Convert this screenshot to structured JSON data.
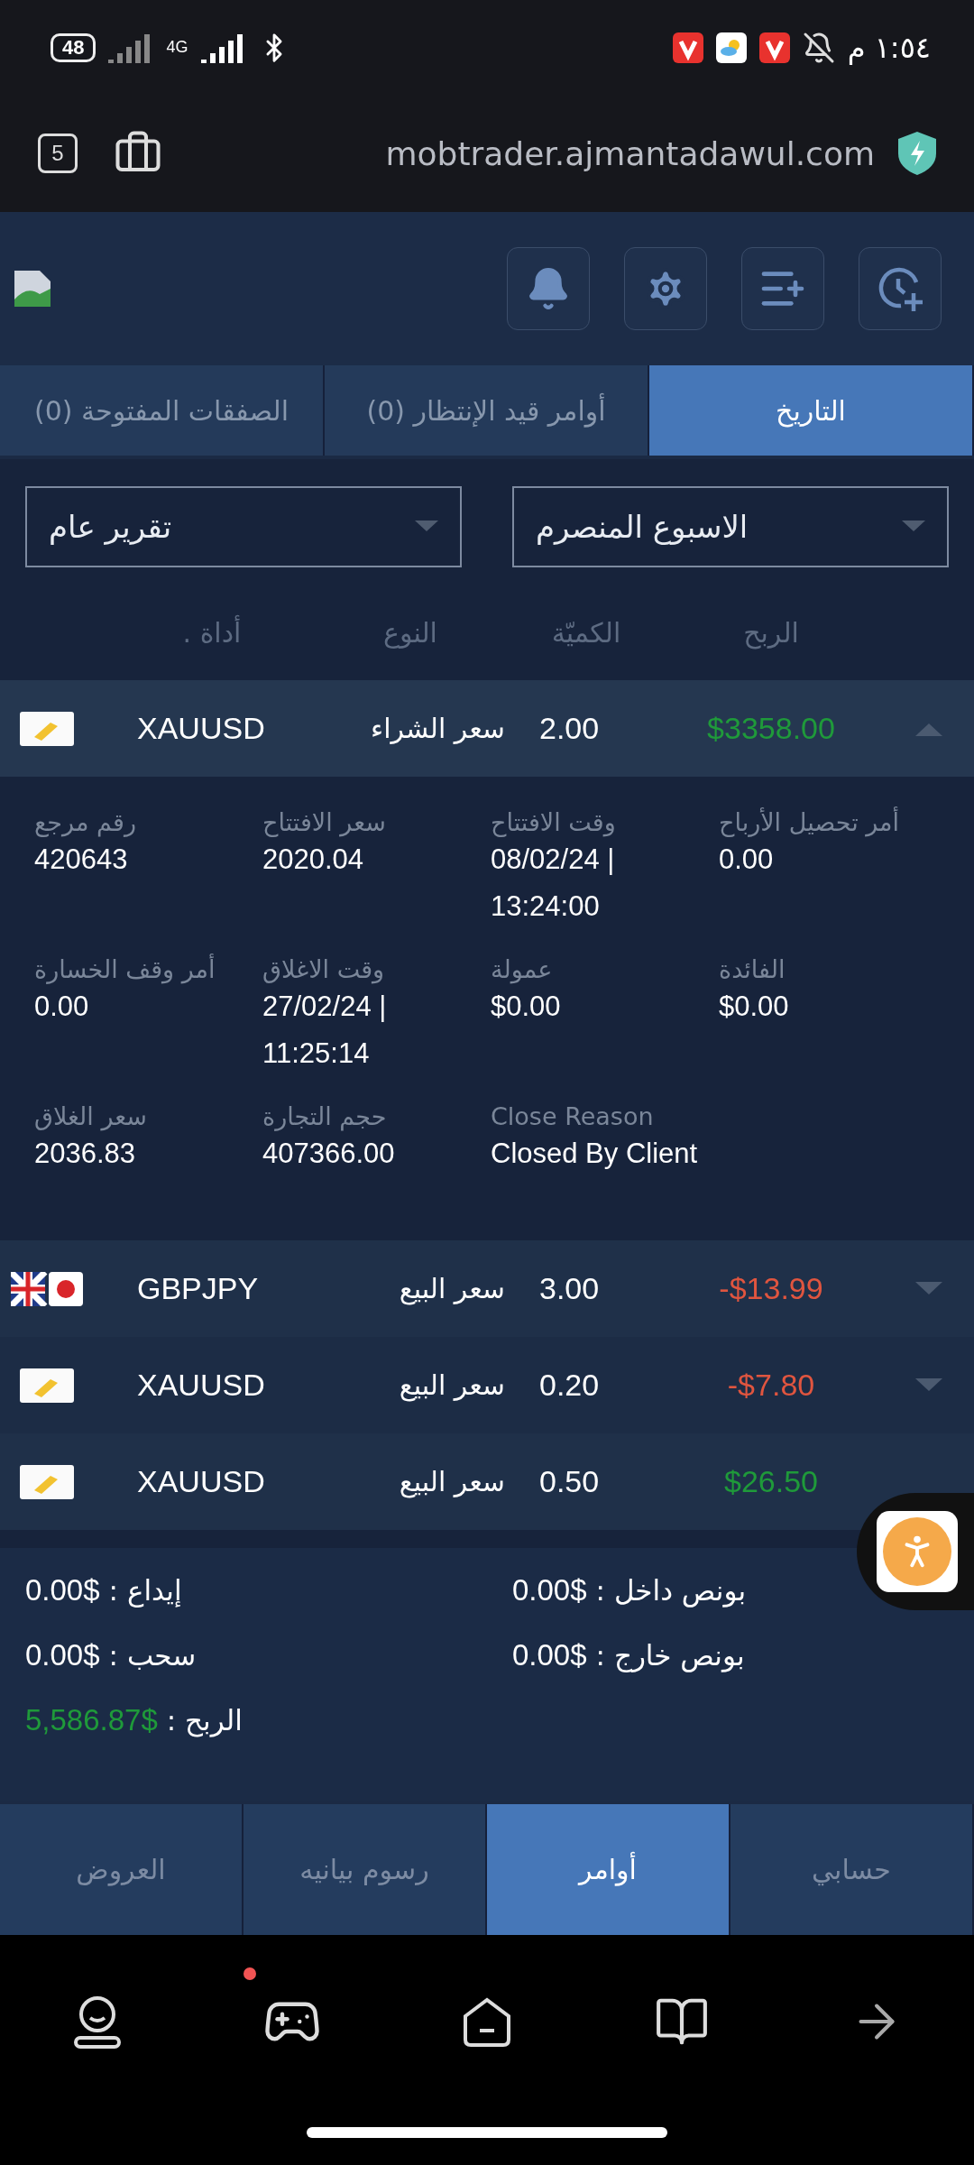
{
  "status_bar": {
    "battery": "48",
    "network": "4G",
    "time": "١:٥٤ م"
  },
  "browser": {
    "tab_count": "5",
    "url": "mobtrader.ajmantadawul.com"
  },
  "tabs": [
    {
      "label": "التاريخ",
      "selected": true
    },
    {
      "label": "أوامر قيد الإنتظار (0)",
      "selected": false
    },
    {
      "label": "الصفقات المفتوحة (0)",
      "selected": false
    }
  ],
  "filters": [
    {
      "value": "الاسبوع المنصرم"
    },
    {
      "value": "تقرير عام"
    }
  ],
  "columns": [
    "الربح",
    "الكميّة",
    "النوع",
    "أداة ."
  ],
  "trades": [
    {
      "kind": "gold",
      "symbol": "XAUUSD",
      "type": "سعر الشراء",
      "quantity": "2.00",
      "profit": "$3358.00",
      "color": "#1f9a3a",
      "expanded": true,
      "caret_visible": true
    },
    {
      "kind": "gbpjpy",
      "symbol": "GBPJPY",
      "type": "سعر البيع",
      "quantity": "3.00",
      "profit": "-$13.99",
      "color": "#e0553f",
      "expanded": false,
      "caret_visible": true
    },
    {
      "kind": "gold",
      "symbol": "XAUUSD",
      "type": "سعر البيع",
      "quantity": "0.20",
      "profit": "-$7.80",
      "color": "#e0553f",
      "expanded": false,
      "caret_visible": true
    },
    {
      "kind": "gold",
      "symbol": "XAUUSD",
      "type": "سعر البيع",
      "quantity": "0.50",
      "profit": "$26.50",
      "color": "#1f9a3a",
      "expanded": false,
      "caret_visible": false
    }
  ],
  "details": [
    {
      "label": "أمر تحصيل الأرباح",
      "value": "0.00"
    },
    {
      "label": "وقت الافتتاح",
      "value": "08/02/24 | 13:24:00"
    },
    {
      "label": "سعر الافتتاح",
      "value": "2020.04"
    },
    {
      "label": "رقم مرجع",
      "value": "420643"
    },
    {
      "label": "الفائدة",
      "value": "$0.00"
    },
    {
      "label": "عمولة",
      "value": "$0.00"
    },
    {
      "label": "وقت الاغلاق",
      "value": "27/02/24 | 11:25:14"
    },
    {
      "label": "أمر وقف الخسارة",
      "value": "0.00"
    },
    {
      "label": "Close Reason",
      "value": "Closed By Client"
    },
    {
      "label": "حجم التجارة",
      "value": "407366.00"
    },
    {
      "label": "سعر الغلاق",
      "value": "2036.83"
    }
  ],
  "summary": [
    {
      "label": "بونص داخل :",
      "value": "0.00$",
      "kind": "plain"
    },
    {
      "label": "إيداع :",
      "value": "0.00$",
      "kind": "plain"
    },
    {
      "label": "بونص خارج :",
      "value": "0.00$",
      "kind": "plain"
    },
    {
      "label": "سحب :",
      "value": "0.00$",
      "kind": "plain"
    },
    {
      "label": "الربح :",
      "value": "5,586.87$",
      "kind": "profit"
    }
  ],
  "bottom_tabs": [
    {
      "label": "حسابي",
      "selected": false
    },
    {
      "label": "أوامر",
      "selected": true
    },
    {
      "label": "رسوم بيانيه",
      "selected": false
    },
    {
      "label": "العروض",
      "selected": false
    }
  ],
  "nav": [
    {
      "kind": "profile",
      "badge": false
    },
    {
      "kind": "games",
      "badge": true
    },
    {
      "kind": "home",
      "badge": false
    },
    {
      "kind": "book",
      "badge": false
    },
    {
      "kind": "forward",
      "badge": false
    }
  ]
}
